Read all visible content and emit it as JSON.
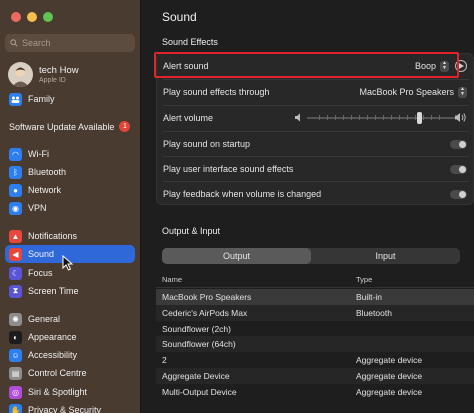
{
  "sidebar": {
    "traffic_colors": [
      "#ed6a5e",
      "#f5bf4f",
      "#61c554"
    ],
    "search_placeholder": "Search",
    "profile": {
      "name": "tech How",
      "subtitle": "Apple ID"
    },
    "family_label": "Family",
    "software_update": {
      "label": "Software Update Available",
      "count": "1"
    },
    "items": [
      {
        "label": "Wi-Fi",
        "icon": "wifi-icon",
        "color": "#2d7ff0"
      },
      {
        "label": "Bluetooth",
        "icon": "bluetooth-icon",
        "color": "#2d7ff0"
      },
      {
        "label": "Network",
        "icon": "globe-icon",
        "color": "#2d7ff0"
      },
      {
        "label": "VPN",
        "icon": "vpn-icon",
        "color": "#2d7ff0"
      },
      {
        "label": "Notifications",
        "icon": "bell-icon",
        "color": "#e8473c"
      },
      {
        "label": "Sound",
        "icon": "speaker-icon",
        "color": "#e8473c"
      },
      {
        "label": "Focus",
        "icon": "moon-icon",
        "color": "#5a55d6"
      },
      {
        "label": "Screen Time",
        "icon": "hourglass-icon",
        "color": "#5a55d6"
      },
      {
        "label": "General",
        "icon": "gear-icon",
        "color": "#8d8d8d"
      },
      {
        "label": "Appearance",
        "icon": "appearance-icon",
        "color": "#1c1c1c"
      },
      {
        "label": "Accessibility",
        "icon": "accessibility-icon",
        "color": "#2d7ff0"
      },
      {
        "label": "Control Centre",
        "icon": "control-centre-icon",
        "color": "#8d8d8d"
      },
      {
        "label": "Siri & Spotlight",
        "icon": "siri-icon",
        "color": "#b14cd8"
      },
      {
        "label": "Privacy & Security",
        "icon": "hand-icon",
        "color": "#2d7ff0"
      }
    ],
    "active_item": "Sound"
  },
  "main": {
    "title": "Sound",
    "sound_effects": {
      "heading": "Sound Effects",
      "alert_sound": {
        "label": "Alert sound",
        "value": "Boop"
      },
      "play_through": {
        "label": "Play sound effects through",
        "value": "MacBook Pro Speakers"
      },
      "alert_volume": {
        "label": "Alert volume",
        "level": 0.75
      },
      "toggles": [
        {
          "label": "Play sound on startup",
          "on": false
        },
        {
          "label": "Play user interface sound effects",
          "on": false
        },
        {
          "label": "Play feedback when volume is changed",
          "on": false
        }
      ]
    },
    "output_input": {
      "heading": "Output & Input",
      "tabs": [
        "Output",
        "Input"
      ],
      "selected_tab": "Output",
      "columns": [
        "Name",
        "Type"
      ],
      "rows": [
        {
          "name": "MacBook Pro Speakers",
          "type": "Built-in"
        },
        {
          "name": "Cederic's AirPods Max",
          "type": "Bluetooth"
        },
        {
          "name": "Soundflower (2ch)",
          "type": ""
        },
        {
          "name": "Soundflower (64ch)",
          "type": ""
        },
        {
          "name": "2",
          "type": "Aggregate device"
        },
        {
          "name": "Aggregate Device",
          "type": "Aggregate device"
        },
        {
          "name": "Multi-Output Device",
          "type": "Aggregate device"
        }
      ]
    }
  }
}
